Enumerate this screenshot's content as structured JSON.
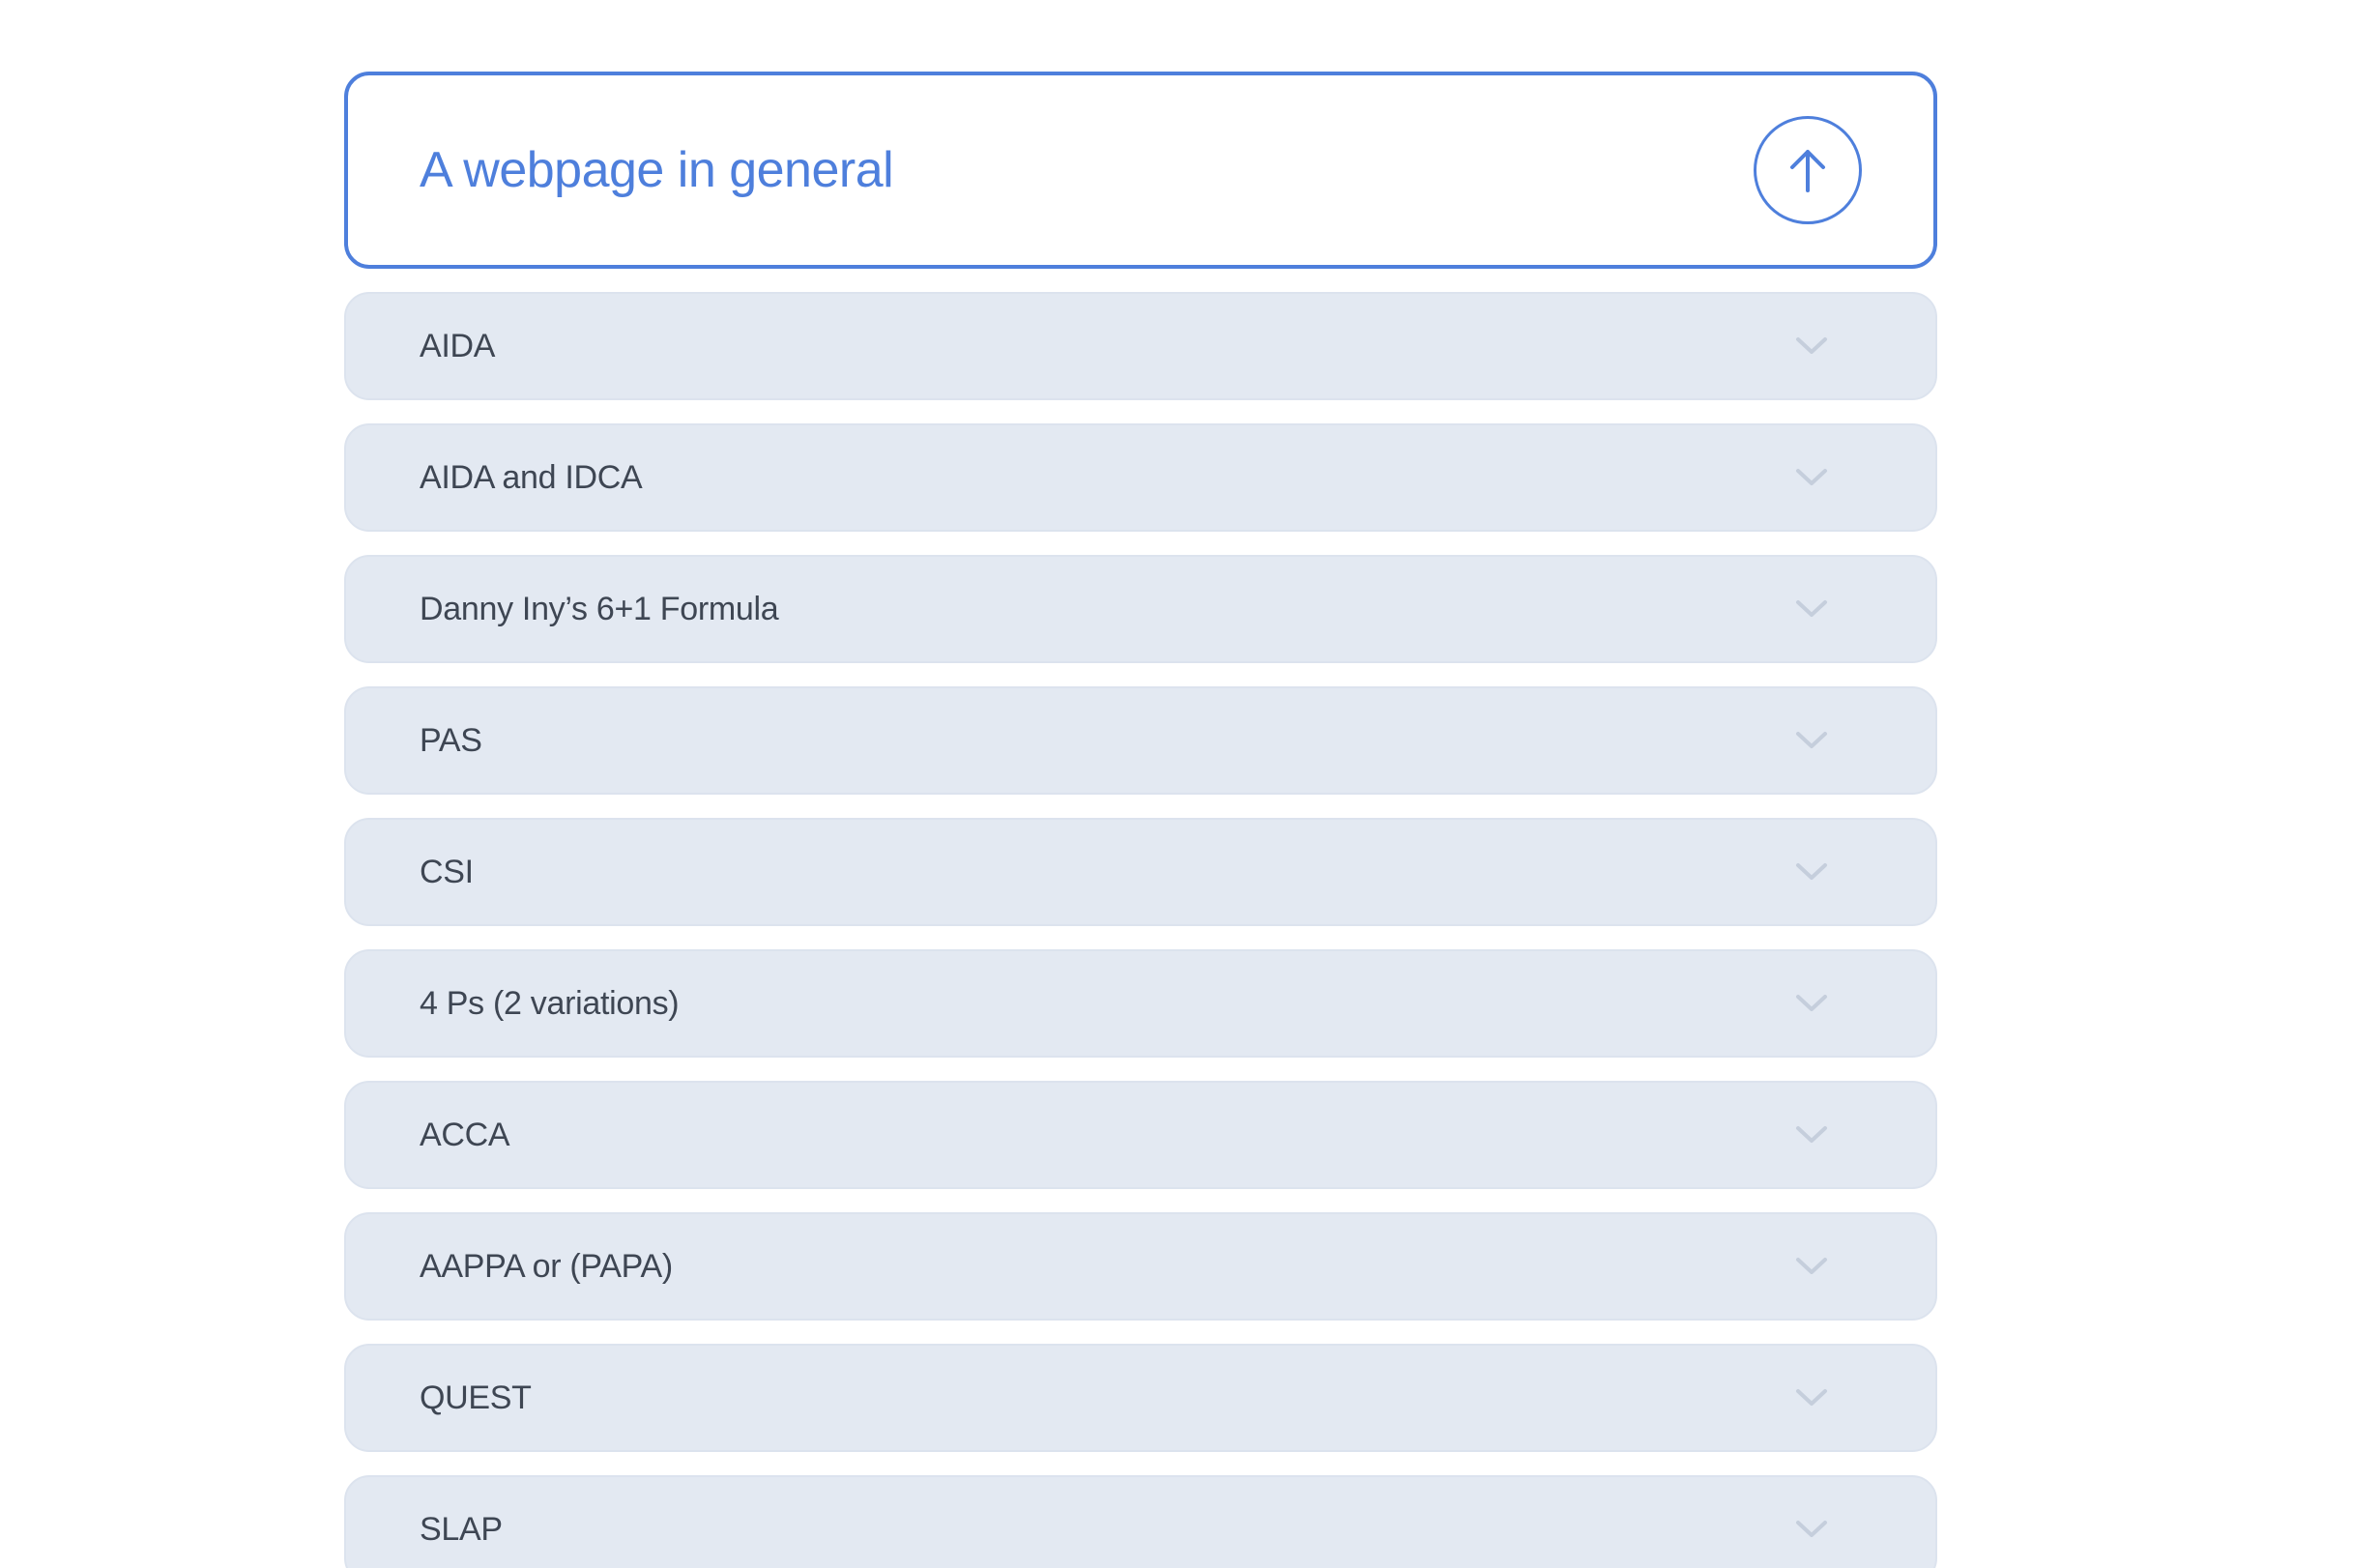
{
  "section": {
    "title": "A webpage in general",
    "toggle_icon": "arrow-up-icon",
    "accent_color": "#4e7fdc"
  },
  "items": [
    {
      "label": "AIDA",
      "icon": "chevron-down-icon"
    },
    {
      "label": "AIDA and IDCA",
      "icon": "chevron-down-icon"
    },
    {
      "label": "Danny Iny’s 6+1 Formula",
      "icon": "chevron-down-icon"
    },
    {
      "label": "PAS",
      "icon": "chevron-down-icon"
    },
    {
      "label": "CSI",
      "icon": "chevron-down-icon"
    },
    {
      "label": "4 Ps (2 variations)",
      "icon": "chevron-down-icon"
    },
    {
      "label": "ACCA",
      "icon": "chevron-down-icon"
    },
    {
      "label": "AAPPA or (PAPA)",
      "icon": "chevron-down-icon"
    },
    {
      "label": "QUEST",
      "icon": "chevron-down-icon"
    },
    {
      "label": "SLAP",
      "icon": "chevron-down-icon"
    }
  ]
}
